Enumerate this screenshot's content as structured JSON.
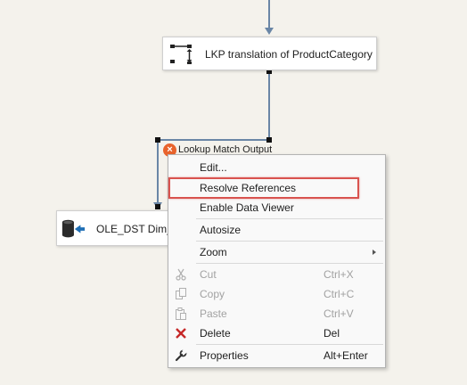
{
  "canvas": {
    "background": "#f4f2ec",
    "connector_color": "#6a86a6"
  },
  "nodes": {
    "lookup": {
      "label": "LKP translation of ProductCategory",
      "icon": "lookup-transform-icon"
    },
    "destination": {
      "label": "OLE_DST Dim_P",
      "icon": "ole-db-destination-icon"
    }
  },
  "path": {
    "label": "Lookup Match Output",
    "badge_icon": "error-x-icon",
    "badge_color": "#e8632c"
  },
  "context_menu": {
    "items": [
      {
        "label": "Edit...",
        "shortcut": "",
        "icon": "",
        "disabled": false
      },
      {
        "label": "Resolve References",
        "shortcut": "",
        "icon": "",
        "disabled": false,
        "highlighted": true
      },
      {
        "label": "Enable Data Viewer",
        "shortcut": "",
        "icon": "",
        "disabled": false
      },
      {
        "label": "Autosize",
        "shortcut": "",
        "icon": "",
        "disabled": false
      },
      {
        "label": "Zoom",
        "shortcut": "",
        "icon": "",
        "disabled": false,
        "submenu": true
      },
      {
        "label": "Cut",
        "shortcut": "Ctrl+X",
        "icon": "scissors-icon",
        "disabled": true
      },
      {
        "label": "Copy",
        "shortcut": "Ctrl+C",
        "icon": "copy-icon",
        "disabled": true
      },
      {
        "label": "Paste",
        "shortcut": "Ctrl+V",
        "icon": "paste-icon",
        "disabled": true
      },
      {
        "label": "Delete",
        "shortcut": "Del",
        "icon": "delete-x-icon",
        "disabled": false
      },
      {
        "label": "Properties",
        "shortcut": "Alt+Enter",
        "icon": "wrench-icon",
        "disabled": false
      }
    ],
    "highlight_color": "#d9534f"
  }
}
